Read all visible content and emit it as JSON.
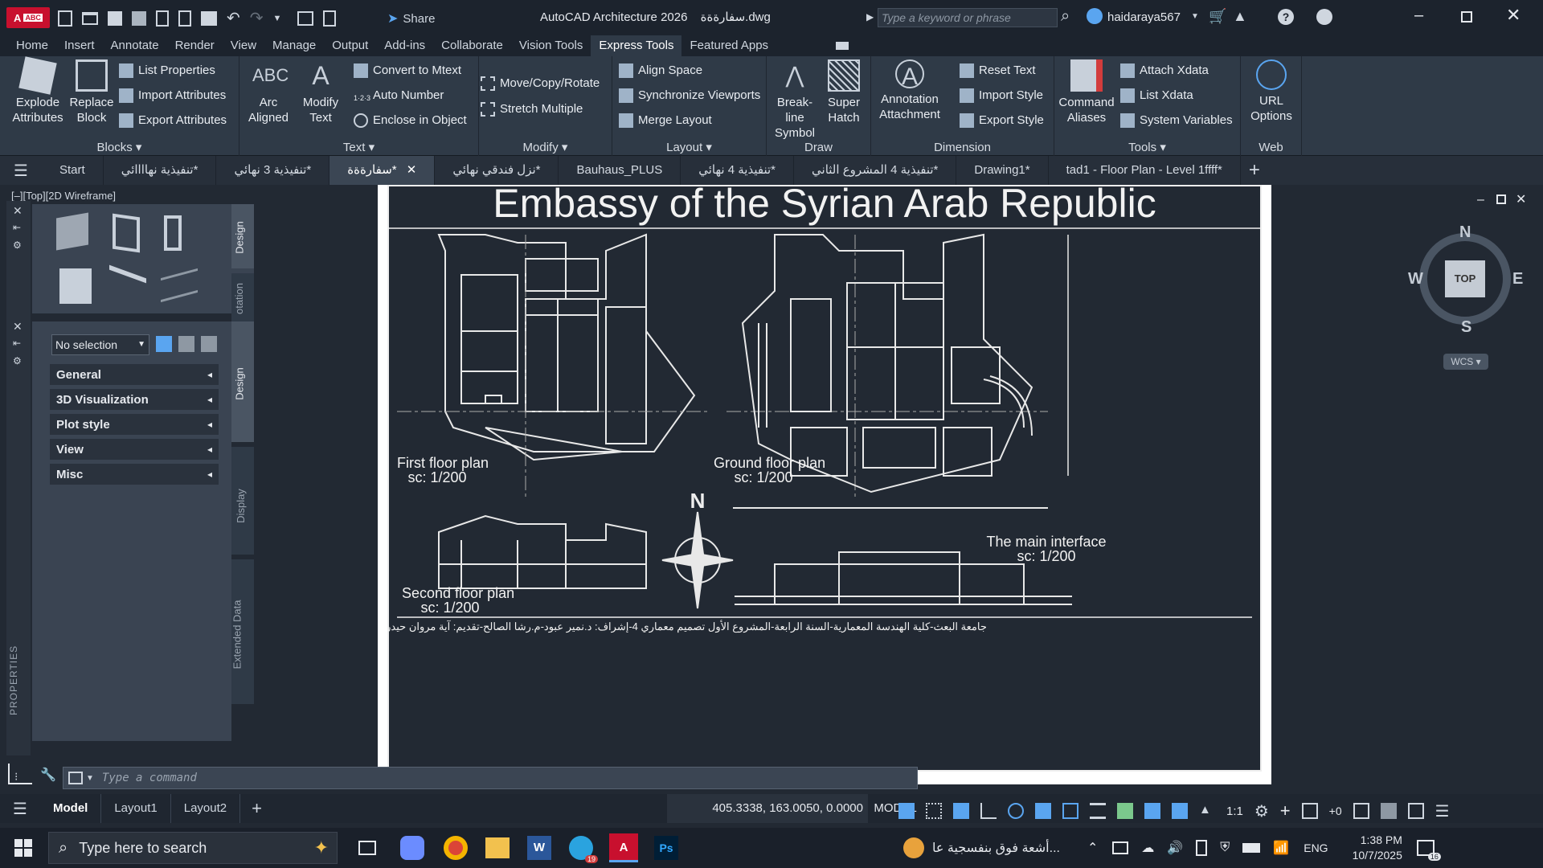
{
  "titlebar": {
    "app_title": "AutoCAD Architecture 2026",
    "file_name": "سفارةةة.dwg",
    "share_label": "Share",
    "search_placeholder": "Type a keyword or phrase",
    "username": "haidaraya567"
  },
  "ribbon_tabs": [
    "Home",
    "Insert",
    "Annotate",
    "Render",
    "View",
    "Manage",
    "Output",
    "Add-ins",
    "Collaborate",
    "Vision Tools",
    "Express Tools",
    "Featured Apps"
  ],
  "ribbon": {
    "blocks": {
      "label": "Blocks",
      "explode": "Explode Attributes",
      "replace": "Replace Block",
      "list_props": "List Properties",
      "import_attr": "Import Attributes",
      "export_attr": "Export Attributes"
    },
    "text": {
      "label": "Text",
      "arc": "Arc Aligned",
      "modify": "Modify Text",
      "convert": "Convert to Mtext",
      "auto_number": "Auto Number",
      "enclose": "Enclose in Object"
    },
    "modify": {
      "label": "Modify",
      "move_copy": "Move/Copy/Rotate",
      "stretch": "Stretch Multiple"
    },
    "layout": {
      "label": "Layout",
      "align_space": "Align Space",
      "sync": "Synchronize Viewports",
      "merge": "Merge Layout"
    },
    "draw": {
      "label": "Draw",
      "breakline": "Break-line Symbol",
      "super_hatch": "Super Hatch"
    },
    "dimension": {
      "label": "Dimension",
      "annotation": "Annotation Attachment",
      "reset_style": "Reset Text",
      "import_style": "Import Style",
      "export_style": "Export Style"
    },
    "tools": {
      "label": "Tools",
      "command_aliases": "Command Aliases",
      "attach_xdata": "Attach Xdata",
      "list_xdata": "List Xdata",
      "system_vars": "System Variables"
    },
    "web": {
      "label": "Web",
      "url_options": "URL Options"
    }
  },
  "doc_tabs": [
    "Start",
    "تنفيذية نهاااائي*",
    "تنفيذية 3 نهائي*",
    "سفارةةة*",
    "نزل فندقي نهائي*",
    "Bauhaus_PLUS",
    "تنفيذية 4 نهائي*",
    "تنفيذية 4 المشروع الثاني*",
    "Drawing1*",
    "tad1 - Floor Plan - Level 1ffff*"
  ],
  "viewport_label": "[–][Top][2D Wireframe]",
  "properties": {
    "selection": "No selection",
    "sections": [
      "General",
      "3D Visualization",
      "Plot style",
      "View",
      "Misc"
    ],
    "side_tabs": [
      "Design",
      "Display",
      "Extended Data"
    ],
    "tool_tabs": [
      "Design",
      "otation"
    ],
    "palette_title": "PROPERTIES"
  },
  "drawing": {
    "title": "Embassy of the Syrian Arab Republic",
    "first_floor": "First floor plan",
    "first_floor_scale": "sc: 1/200",
    "ground_floor": "Ground floor plan",
    "ground_floor_scale": "sc: 1/200",
    "second_floor": "Second floor plan",
    "second_floor_scale": "sc: 1/200",
    "main_interface": "The main interface",
    "main_interface_scale": "sc: 1/200",
    "footer": "جامعة البعث-كلية الهندسة المعمارية-السنة الرابعة-المشروع الأول تصميم معماري 4-إشراف: د.نمير عبود-م.رشا الصالح-تقديم: آية مروان حيدر",
    "north": "N"
  },
  "viewcube": {
    "n": "N",
    "s": "S",
    "e": "E",
    "w": "W",
    "top": "TOP",
    "wcs": "WCS"
  },
  "command_placeholder": "Type a command",
  "status": {
    "layout_tabs": [
      "Model",
      "Layout1",
      "Layout2"
    ],
    "coords": "405.3338, 163.0050, 0.0000",
    "mode": "MODEL",
    "scale": "1:1",
    "plus_zero": "+0"
  },
  "taskbar": {
    "search_placeholder": "Type here to search",
    "weather": "أشعة فوق بنفسجية عا...",
    "lang": "ENG",
    "time": "1:38 PM",
    "date": "10/7/2025",
    "notif_count": "16",
    "telegram_badge": "19"
  }
}
